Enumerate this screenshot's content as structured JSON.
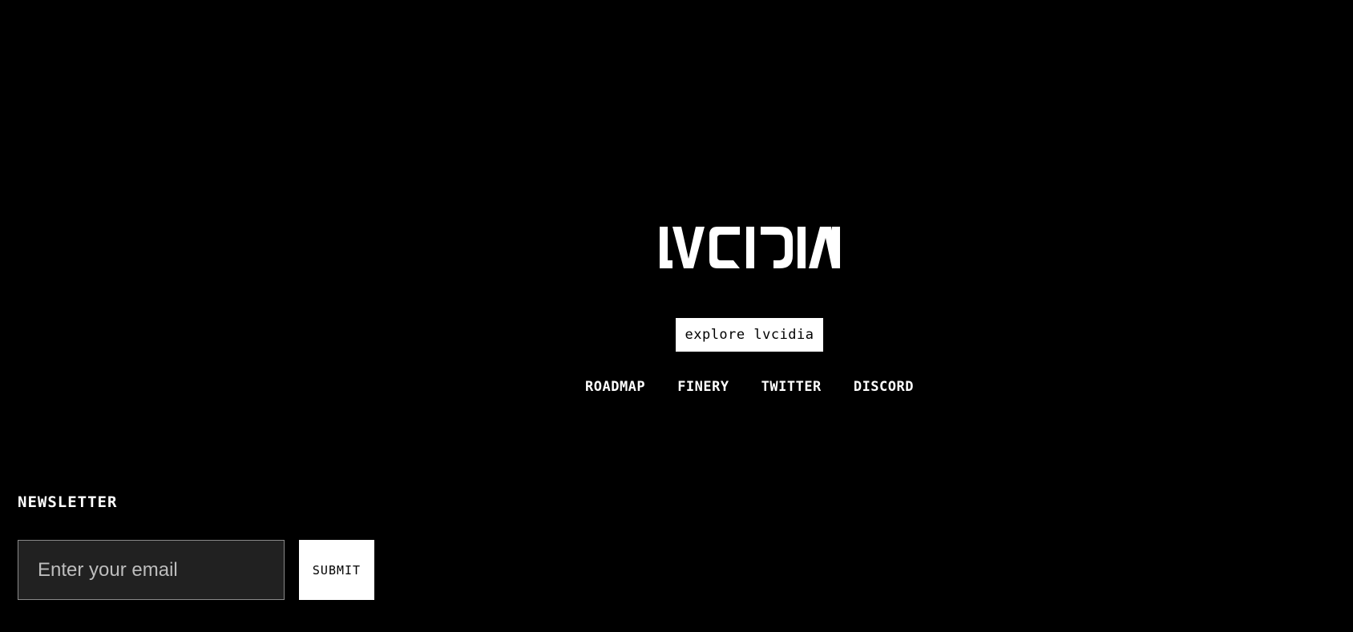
{
  "brand": {
    "logo_icon": "lvcidia-wordmark-logo",
    "logo_text": "LVCIDIA"
  },
  "hero": {
    "explore_label": "explore lvcidia"
  },
  "nav": {
    "items": [
      {
        "label": "ROADMAP"
      },
      {
        "label": "FINERY"
      },
      {
        "label": "TWITTER"
      },
      {
        "label": "DISCORD"
      }
    ]
  },
  "newsletter": {
    "title": "NEWSLETTER",
    "email_placeholder": "Enter your email",
    "email_value": "",
    "submit_label": "SUBMIT"
  },
  "colors": {
    "background": "#000000",
    "foreground": "#ffffff",
    "input_background": "#212121",
    "input_border": "#8a8a8a"
  }
}
